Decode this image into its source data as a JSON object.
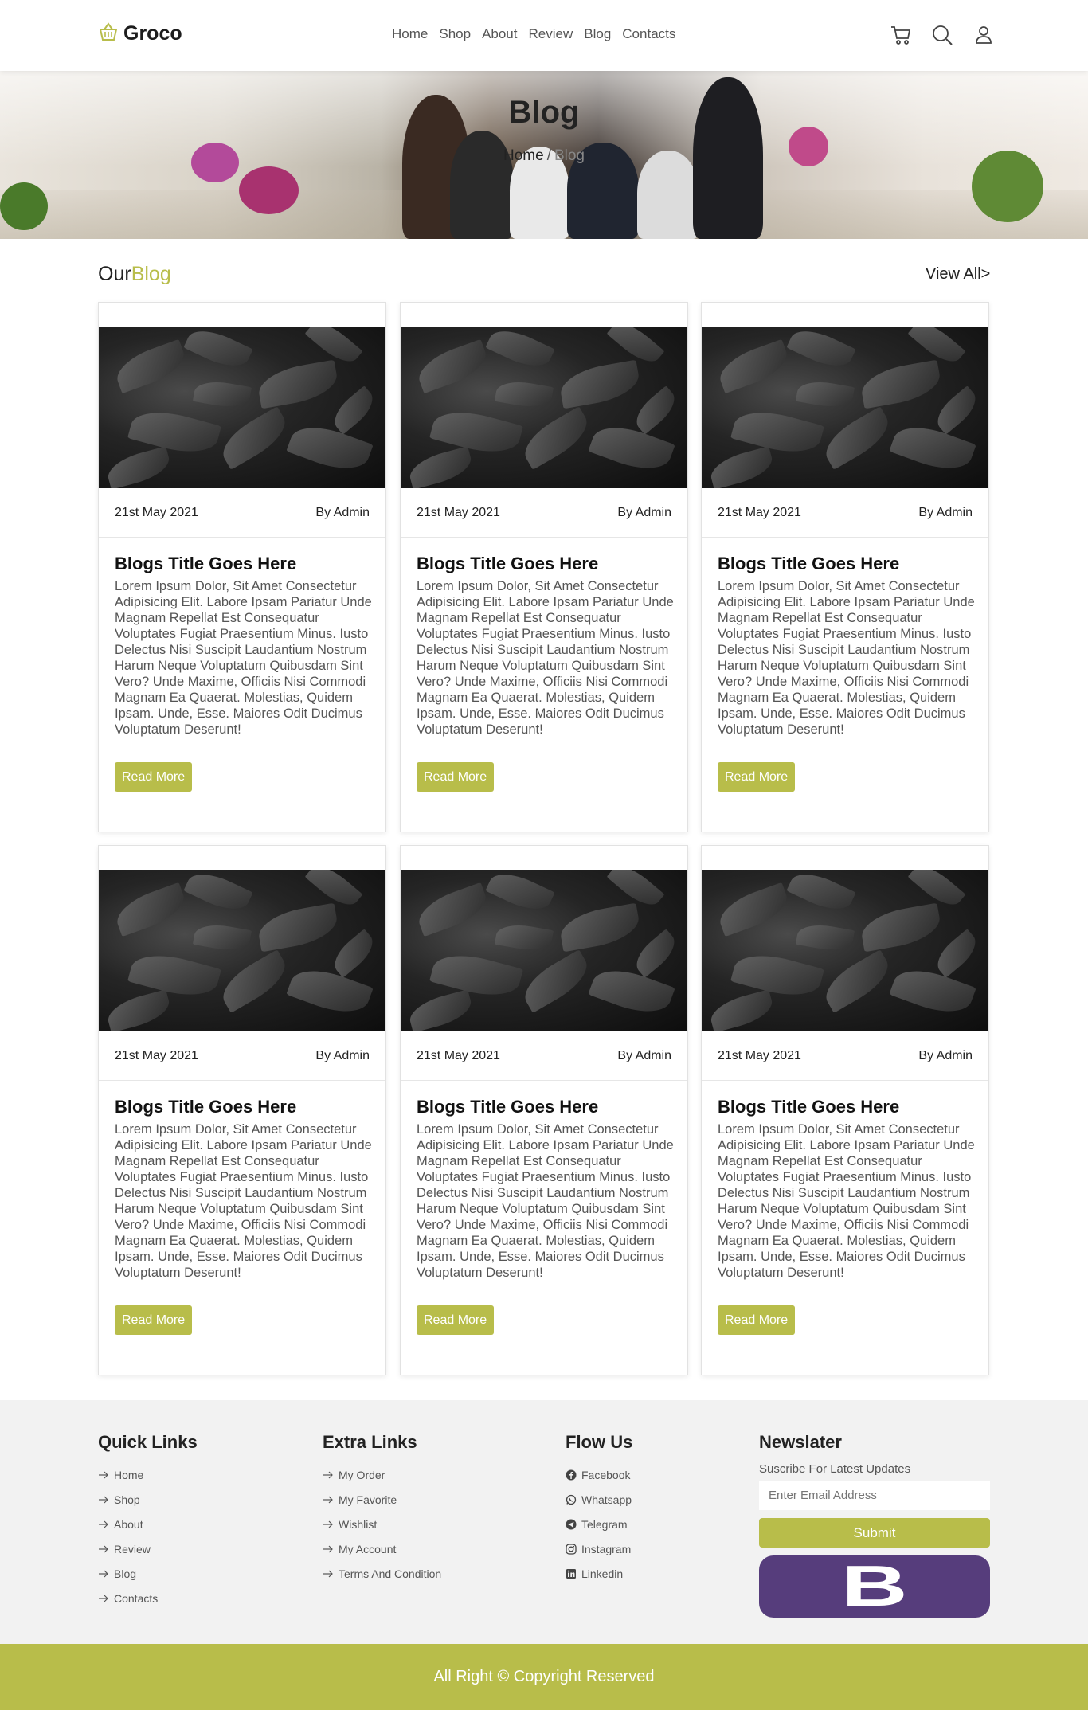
{
  "header": {
    "logo_text": "Groco",
    "nav": [
      "Home",
      "Shop",
      "About",
      "Review",
      "Blog",
      "Contacts"
    ],
    "icons": [
      "cart-icon",
      "search-icon",
      "user-icon"
    ]
  },
  "banner": {
    "title": "Blog",
    "breadcrumb_home": "Home",
    "breadcrumb_sep": "/",
    "breadcrumb_current": "Blog"
  },
  "section": {
    "title_part1": "Our",
    "title_part2": "Blog",
    "view_all": "View All>"
  },
  "cards": [
    {
      "date": "21st May 2021",
      "author": "By Admin",
      "title": "Blogs Title Goes Here",
      "text": "Lorem Ipsum Dolor, Sit Amet Consectetur Adipisicing Elit. Labore Ipsam Pariatur Unde Magnam Repellat Est Consequatur Voluptates Fugiat Praesentium Minus. Iusto Delectus Nisi Suscipit Laudantium Nostrum Harum Neque Voluptatum Quibusdam Sint Vero? Unde Maxime, Officiis Nisi Commodi Magnam Ea Quaerat. Molestias, Quidem Ipsam. Unde, Esse. Maiores Odit Ducimus Voluptatum Deserunt!",
      "button": "Read More"
    },
    {
      "date": "21st May 2021",
      "author": "By Admin",
      "title": "Blogs Title Goes Here",
      "text": "Lorem Ipsum Dolor, Sit Amet Consectetur Adipisicing Elit. Labore Ipsam Pariatur Unde Magnam Repellat Est Consequatur Voluptates Fugiat Praesentium Minus. Iusto Delectus Nisi Suscipit Laudantium Nostrum Harum Neque Voluptatum Quibusdam Sint Vero? Unde Maxime, Officiis Nisi Commodi Magnam Ea Quaerat. Molestias, Quidem Ipsam. Unde, Esse. Maiores Odit Ducimus Voluptatum Deserunt!",
      "button": "Read More"
    },
    {
      "date": "21st May 2021",
      "author": "By Admin",
      "title": "Blogs Title Goes Here",
      "text": "Lorem Ipsum Dolor, Sit Amet Consectetur Adipisicing Elit. Labore Ipsam Pariatur Unde Magnam Repellat Est Consequatur Voluptates Fugiat Praesentium Minus. Iusto Delectus Nisi Suscipit Laudantium Nostrum Harum Neque Voluptatum Quibusdam Sint Vero? Unde Maxime, Officiis Nisi Commodi Magnam Ea Quaerat. Molestias, Quidem Ipsam. Unde, Esse. Maiores Odit Ducimus Voluptatum Deserunt!",
      "button": "Read More"
    },
    {
      "date": "21st May 2021",
      "author": "By Admin",
      "title": "Blogs Title Goes Here",
      "text": "Lorem Ipsum Dolor, Sit Amet Consectetur Adipisicing Elit. Labore Ipsam Pariatur Unde Magnam Repellat Est Consequatur Voluptates Fugiat Praesentium Minus. Iusto Delectus Nisi Suscipit Laudantium Nostrum Harum Neque Voluptatum Quibusdam Sint Vero? Unde Maxime, Officiis Nisi Commodi Magnam Ea Quaerat. Molestias, Quidem Ipsam. Unde, Esse. Maiores Odit Ducimus Voluptatum Deserunt!",
      "button": "Read More"
    },
    {
      "date": "21st May 2021",
      "author": "By Admin",
      "title": "Blogs Title Goes Here",
      "text": "Lorem Ipsum Dolor, Sit Amet Consectetur Adipisicing Elit. Labore Ipsam Pariatur Unde Magnam Repellat Est Consequatur Voluptates Fugiat Praesentium Minus. Iusto Delectus Nisi Suscipit Laudantium Nostrum Harum Neque Voluptatum Quibusdam Sint Vero? Unde Maxime, Officiis Nisi Commodi Magnam Ea Quaerat. Molestias, Quidem Ipsam. Unde, Esse. Maiores Odit Ducimus Voluptatum Deserunt!",
      "button": "Read More"
    },
    {
      "date": "21st May 2021",
      "author": "By Admin",
      "title": "Blogs Title Goes Here",
      "text": "Lorem Ipsum Dolor, Sit Amet Consectetur Adipisicing Elit. Labore Ipsam Pariatur Unde Magnam Repellat Est Consequatur Voluptates Fugiat Praesentium Minus. Iusto Delectus Nisi Suscipit Laudantium Nostrum Harum Neque Voluptatum Quibusdam Sint Vero? Unde Maxime, Officiis Nisi Commodi Magnam Ea Quaerat. Molestias, Quidem Ipsam. Unde, Esse. Maiores Odit Ducimus Voluptatum Deserunt!",
      "button": "Read More"
    }
  ],
  "footer": {
    "quick_links": {
      "title": "Quick Links",
      "items": [
        "Home",
        "Shop",
        "About",
        "Review",
        "Blog",
        "Contacts"
      ]
    },
    "extra_links": {
      "title": "Extra Links",
      "items": [
        "My Order",
        "My Favorite",
        "Wishlist",
        "My Account",
        "Terms And Condition"
      ]
    },
    "follow": {
      "title": "Flow Us",
      "items": [
        "Facebook",
        "Whatsapp",
        "Telegram",
        "Instagram",
        "Linkedin"
      ],
      "icons": [
        "facebook-icon",
        "whatsapp-icon",
        "telegram-icon",
        "instagram-icon",
        "linkedin-icon"
      ]
    },
    "newsletter": {
      "title": "Newslater",
      "subtitle": "Suscribe For Latest Updates",
      "placeholder": "Enter Email Address",
      "button": "Submit",
      "logo_letter": "B"
    }
  },
  "copyright": "All Right © Copyright Reserved",
  "colors": {
    "accent": "#b8bd4a",
    "footer_bg": "#f2f2f2",
    "logo_bg": "#563d7c"
  }
}
